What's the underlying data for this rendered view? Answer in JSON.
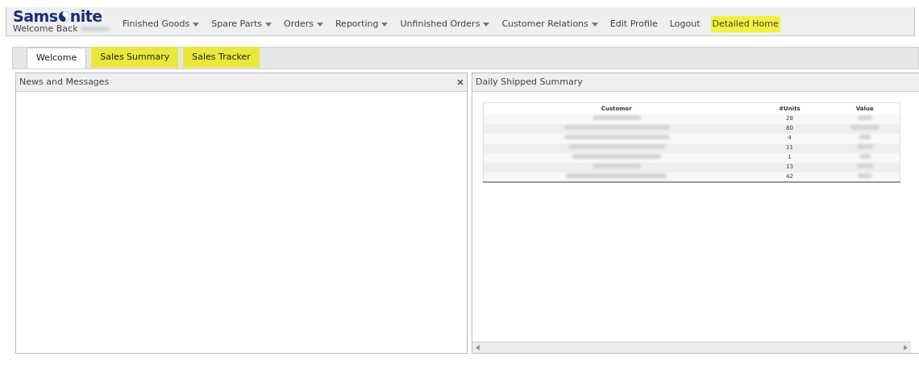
{
  "header": {
    "logo_left": "Sams",
    "logo_right": "nite",
    "welcome": "Welcome Back",
    "nav": [
      {
        "label": "Finished Goods",
        "dropdown": true,
        "highlighted": false
      },
      {
        "label": "Spare Parts",
        "dropdown": true,
        "highlighted": false
      },
      {
        "label": "Orders",
        "dropdown": true,
        "highlighted": false
      },
      {
        "label": "Reporting",
        "dropdown": true,
        "highlighted": false
      },
      {
        "label": "Unfinished Orders",
        "dropdown": true,
        "highlighted": false
      },
      {
        "label": "Customer Relations",
        "dropdown": true,
        "highlighted": false
      },
      {
        "label": "Edit Profile",
        "dropdown": false,
        "highlighted": false
      },
      {
        "label": "Logout",
        "dropdown": false,
        "highlighted": false
      },
      {
        "label": "Detailed Home",
        "dropdown": false,
        "highlighted": true
      }
    ]
  },
  "tabs": [
    {
      "label": "Welcome",
      "selected": true,
      "highlighted": false
    },
    {
      "label": "Sales Summary",
      "selected": false,
      "highlighted": true
    },
    {
      "label": "Sales Tracker",
      "selected": false,
      "highlighted": true
    }
  ],
  "panels": [
    {
      "title": "News and Messages",
      "closable": true
    },
    {
      "title": "Daily Shipped Summary",
      "closable": false,
      "table": {
        "columns": [
          "Customer",
          "#Units",
          "Value"
        ],
        "rows": [
          {
            "units": "28"
          },
          {
            "units": "80"
          },
          {
            "units": "4"
          },
          {
            "units": "11"
          },
          {
            "units": "1"
          },
          {
            "units": "13"
          },
          {
            "units": "42"
          }
        ]
      }
    }
  ]
}
